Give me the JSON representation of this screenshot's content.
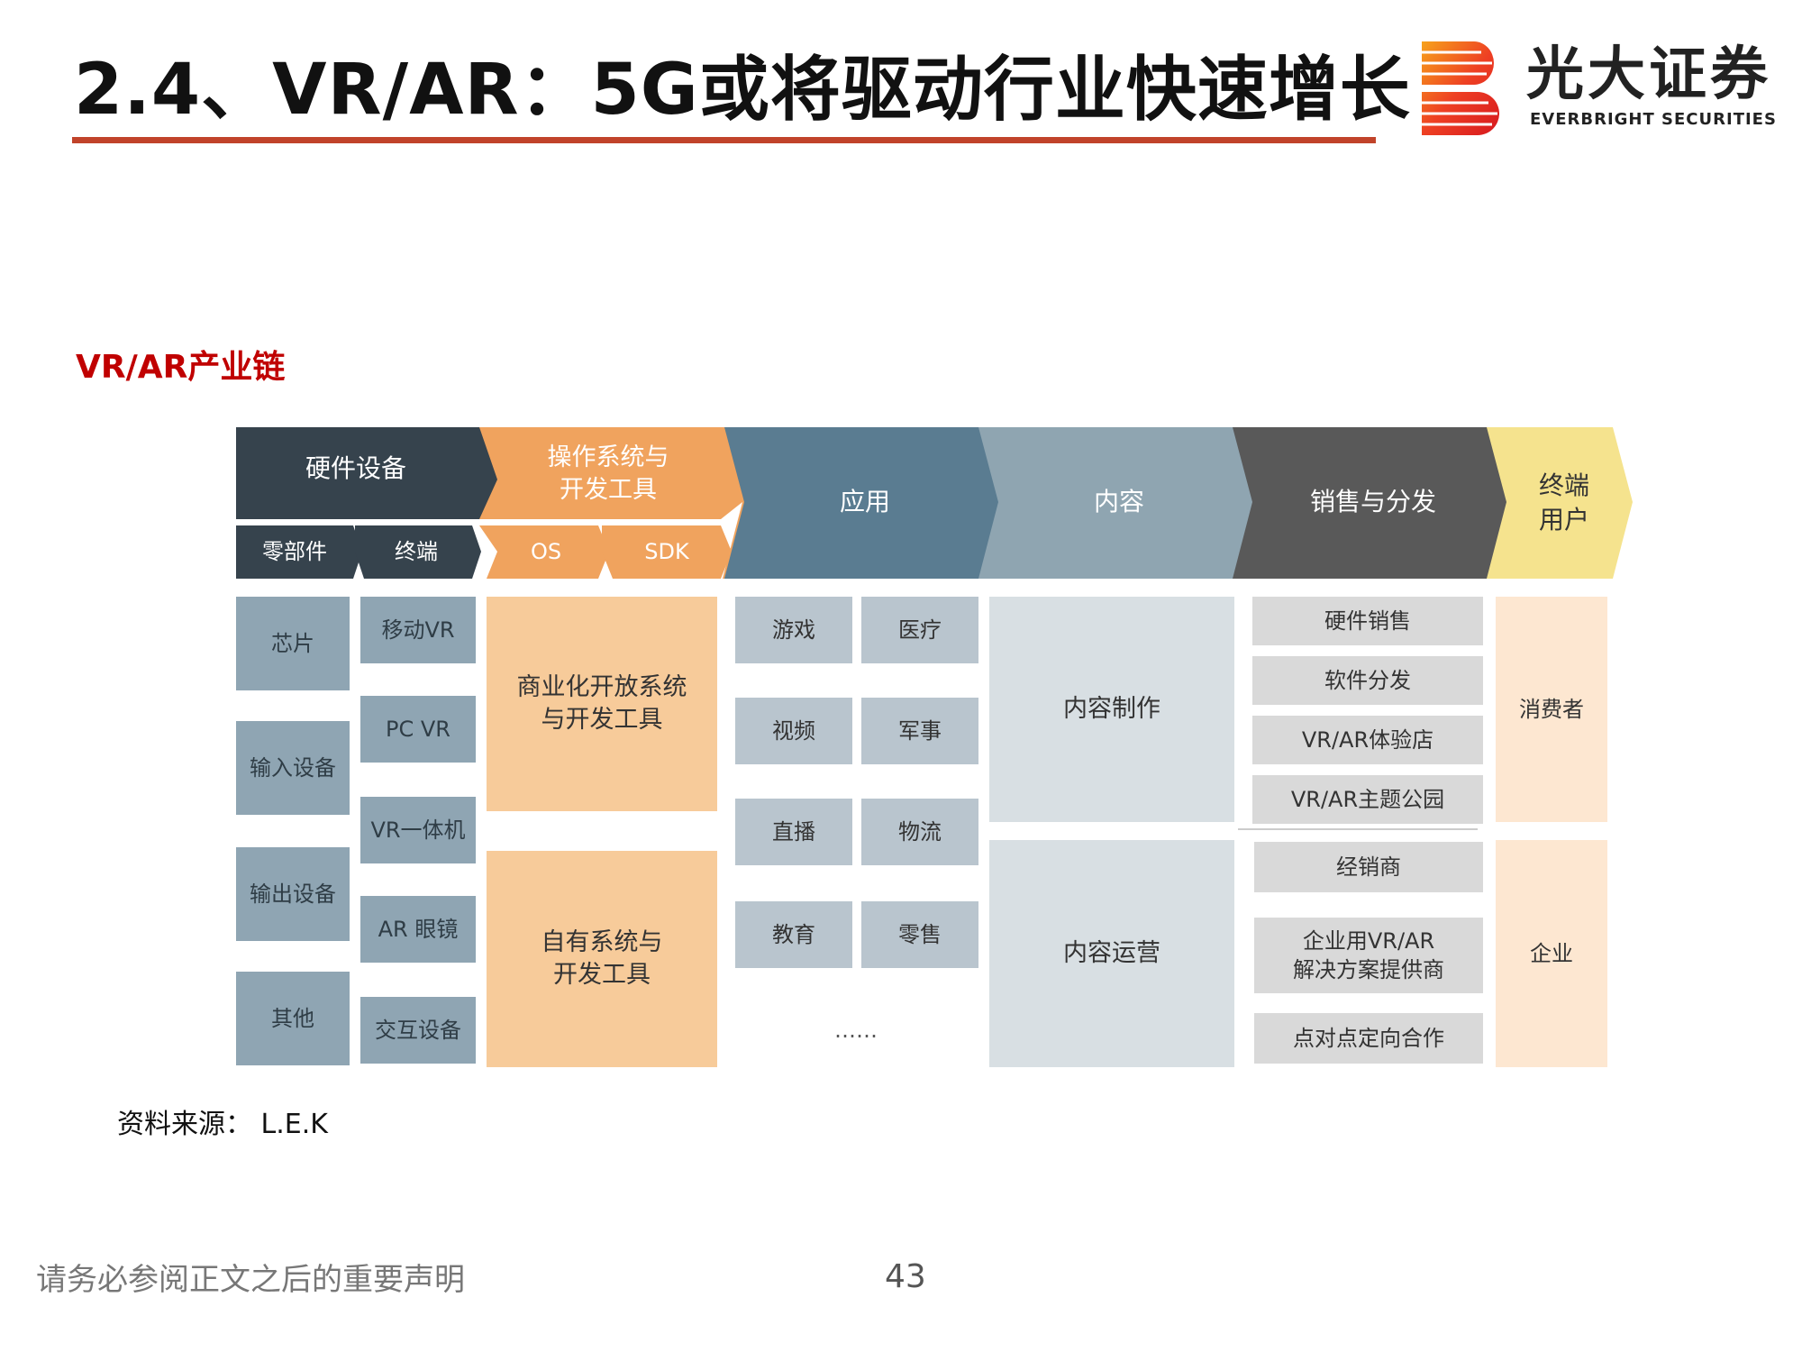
{
  "header": {
    "title": "2.4、VR/AR：5G或将驱动行业快速增长",
    "logo_cn": "光大证券",
    "logo_en": "EVERBRIGHT SECURITIES"
  },
  "subtitle": "VR/AR产业链",
  "stages": {
    "hardware": "硬件设备",
    "hardware_sub_parts": "零部件",
    "hardware_sub_terminal": "终端",
    "os": "操作系统与\n开发工具",
    "os_sub_os": "OS",
    "os_sub_sdk": "SDK",
    "app": "应用",
    "content": "内容",
    "sales": "销售与分发",
    "enduser": "终端\n用户"
  },
  "parts": [
    "芯片",
    "输入设备",
    "输出设备",
    "其他"
  ],
  "terminals": [
    "移动VR",
    "PC VR",
    "VR一体机",
    "AR 眼镜",
    "交互设备"
  ],
  "os_items": [
    "商业化开放系统\n与开发工具",
    "自有系统与\n开发工具"
  ],
  "apps": [
    "游戏",
    "医疗",
    "视频",
    "军事",
    "直播",
    "物流",
    "教育",
    "零售"
  ],
  "apps_more": "……",
  "contents": [
    "内容制作",
    "内容运营"
  ],
  "sales_consumer": [
    "硬件销售",
    "软件分发",
    "VR/AR体验店",
    "VR/AR主题公园"
  ],
  "sales_enterprise": [
    "经销商",
    "企业用VR/AR\n解决方案提供商",
    "点对点定向合作"
  ],
  "users": [
    "消费者",
    "企业"
  ],
  "source": "资料来源： L.E.K",
  "footer": {
    "disclaimer": "请务必参阅正文之后的重要声明",
    "page": "43"
  },
  "colors": {
    "accent_red": "#c1432a",
    "hardware": "#36434d",
    "os": "#f0a35e",
    "app": "#5a7c91",
    "content": "#8fa5b1",
    "sales": "#595959",
    "enduser": "#f5e38e"
  }
}
